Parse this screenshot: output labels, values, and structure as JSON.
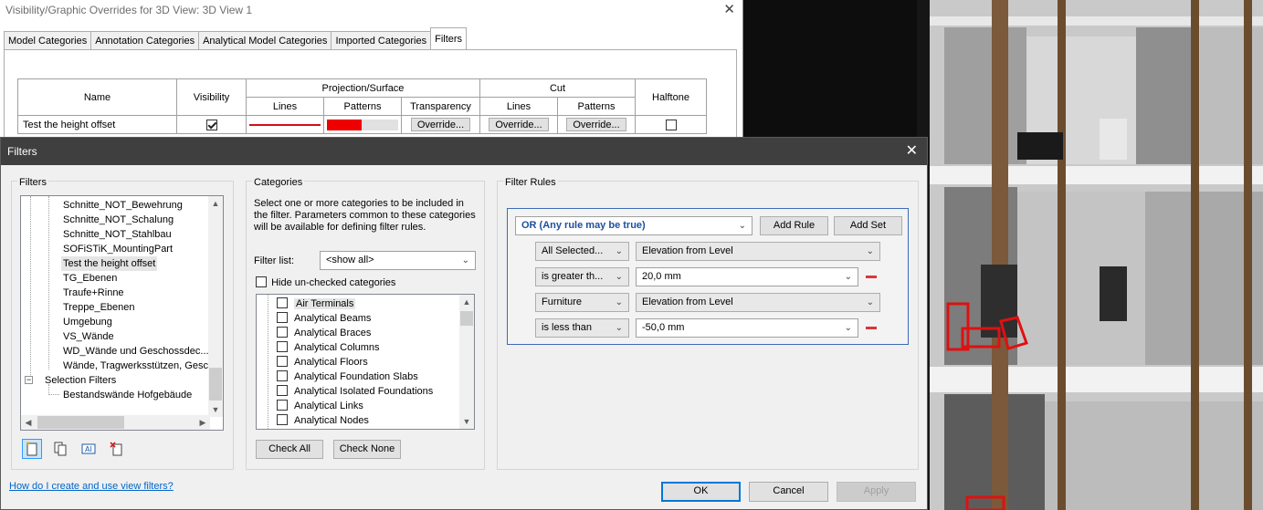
{
  "vg_window": {
    "title": "Visibility/Graphic Overrides for 3D View: 3D View 1",
    "tabs": [
      "Model Categories",
      "Annotation Categories",
      "Analytical Model Categories",
      "Imported Categories",
      "Filters"
    ],
    "active_tab": "Filters",
    "table": {
      "name_header": "Name",
      "visibility_header": "Visibility",
      "projection_header": "Projection/Surface",
      "cut_header": "Cut",
      "halftone_header": "Halftone",
      "lines_header": "Lines",
      "patterns_header": "Patterns",
      "transparency_header": "Transparency",
      "row": {
        "name": "Test the height offset",
        "visibility_checked": true,
        "line_color": "#d0101a",
        "pattern_color": "#ee0000",
        "transparency_button": "Override...",
        "cut_lines_button": "Override...",
        "cut_patterns_button": "Override...",
        "halftone_checked": false
      }
    }
  },
  "filters_dialog": {
    "title": "Filters",
    "filters_group_label": "Filters",
    "filters_tree": [
      "Schnitte_NOT_Bewehrung",
      "Schnitte_NOT_Schalung",
      "Schnitte_NOT_Stahlbau",
      "SOFiSTiK_MountingPart",
      "Test the height offset",
      "TG_Ebenen",
      "Traufe+Rinne",
      "Treppe_Ebenen",
      "Umgebung",
      "VS_Wände",
      "WD_Wände und Geschossdec...",
      "Wände, Tragwerksstützen, Gesch"
    ],
    "selected_filter": "Test the height offset",
    "selection_filters_label": "Selection Filters",
    "selection_filters": [
      "Bestandswände Hofgebäude"
    ],
    "categories_group_label": "Categories",
    "categories_description": "Select one or more categories to be included in the filter.  Parameters common to these categories will be available for defining filter rules.",
    "filter_list_label": "Filter list:",
    "filter_list_value": "<show all>",
    "hide_unchecked_label": "Hide un-checked categories",
    "categories": [
      "Air Terminals",
      "Analytical Beams",
      "Analytical Braces",
      "Analytical Columns",
      "Analytical Floors",
      "Analytical Foundation Slabs",
      "Analytical Isolated Foundations",
      "Analytical Links",
      "Analytical Nodes"
    ],
    "check_all_button": "Check All",
    "check_none_button": "Check None",
    "filter_rules_group_label": "Filter Rules",
    "rule_set_operator": "OR (Any rule may be true)",
    "add_rule_button": "Add Rule",
    "add_set_button": "Add Set",
    "rules": [
      {
        "category": "All Selected...",
        "parameter": "Elevation from Level"
      },
      {
        "operator": "is greater th...",
        "value": "20,0 mm"
      },
      {
        "category": "Furniture",
        "parameter": "Elevation from Level"
      },
      {
        "operator": "is less than",
        "value": "-50,0 mm"
      }
    ],
    "help_link": "How do I create and use view filters?",
    "ok_button": "OK",
    "cancel_button": "Cancel",
    "apply_button": "Apply",
    "accent_color": "#0078d7",
    "rule_set_border_color": "#3c6bb5",
    "remove_rule_color": "#d9373a"
  },
  "viewport": {
    "highlight_color": "#e01010"
  }
}
